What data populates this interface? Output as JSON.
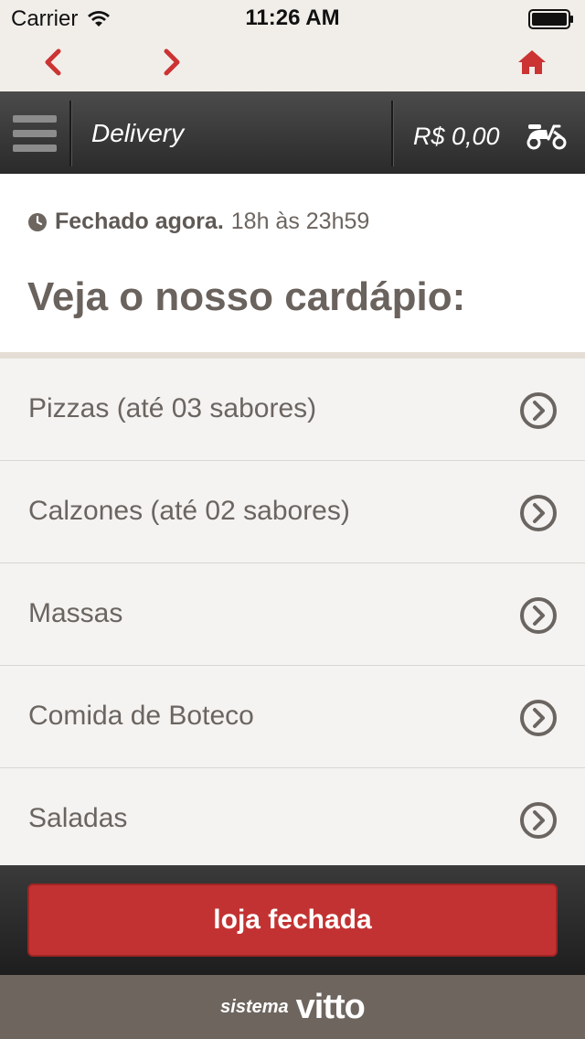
{
  "status_bar": {
    "carrier": "Carrier",
    "time": "11:26 AM"
  },
  "nav": {
    "back_icon": "chevron-left-icon",
    "forward_icon": "chevron-right-icon",
    "home_icon": "home-icon",
    "accent_color": "#cc3333"
  },
  "toolbar": {
    "title": "Delivery",
    "cart_total": "R$ 0,00",
    "menu_icon": "hamburger-icon",
    "delivery_icon": "scooter-icon"
  },
  "store_status": {
    "state": "Fechado agora.",
    "hours": "18h às 23h59"
  },
  "menu_heading": "Veja o nosso cardápio:",
  "categories": [
    {
      "label": "Pizzas (até 03 sabores)"
    },
    {
      "label": "Calzones (até 02 sabores)"
    },
    {
      "label": "Massas"
    },
    {
      "label": "Comida de Boteco"
    },
    {
      "label": "Saladas"
    }
  ],
  "action_button": {
    "label": "loja fechada",
    "color": "#c33232"
  },
  "footer": {
    "prefix": "sistema",
    "brand": "vitto"
  }
}
